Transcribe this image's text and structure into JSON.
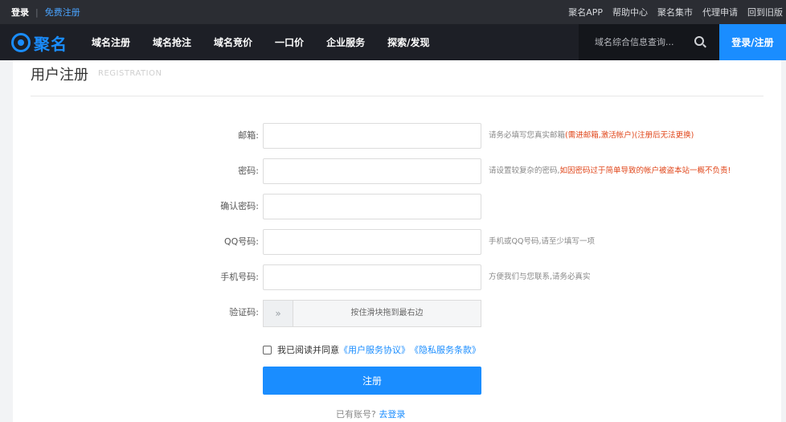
{
  "topbar": {
    "login": "登录",
    "separator": "|",
    "register": "免费注册",
    "links": [
      "聚名APP",
      "帮助中心",
      "聚名集市",
      "代理申请",
      "回到旧版"
    ]
  },
  "nav": {
    "logo_text": "聚名",
    "items": [
      "域名注册",
      "域名抢注",
      "域名竞价",
      "一口价",
      "企业服务",
      "探索/发现"
    ],
    "search_placeholder": "域名综合信息查询...",
    "login_register": "登录/注册"
  },
  "page": {
    "title": "用户注册",
    "subtitle": "REGISTRATION"
  },
  "form": {
    "email": {
      "label": "邮箱:",
      "hint": "请务必填写您真实邮箱",
      "hint_warn": "(需进邮箱,激活帐户)(注册后无法更换)"
    },
    "password": {
      "label": "密码:",
      "hint": "请设置较复杂的密码,",
      "hint_warn": "如因密码过于简单导致的帐户被盗本站一概不负责!"
    },
    "confirm": {
      "label": "确认密码:"
    },
    "qq": {
      "label": "QQ号码:",
      "hint": "手机或QQ号码,请至少填写一项"
    },
    "phone": {
      "label": "手机号码:",
      "hint": "方便我们与您联系,请务必真实"
    },
    "captcha": {
      "label": "验证码:",
      "handle": "»",
      "text": "按住滑块拖到最右边"
    },
    "agree": {
      "prefix": "我已阅读并同意",
      "terms": "《用户服务协议》",
      "privacy": "《隐私服务条款》"
    },
    "submit": "注册",
    "have_account": "已有账号?",
    "go_login": "去登录"
  },
  "colors": {
    "accent": "#1a8dff",
    "warn": "#e0461a",
    "nav_bg": "#1d1f26"
  }
}
